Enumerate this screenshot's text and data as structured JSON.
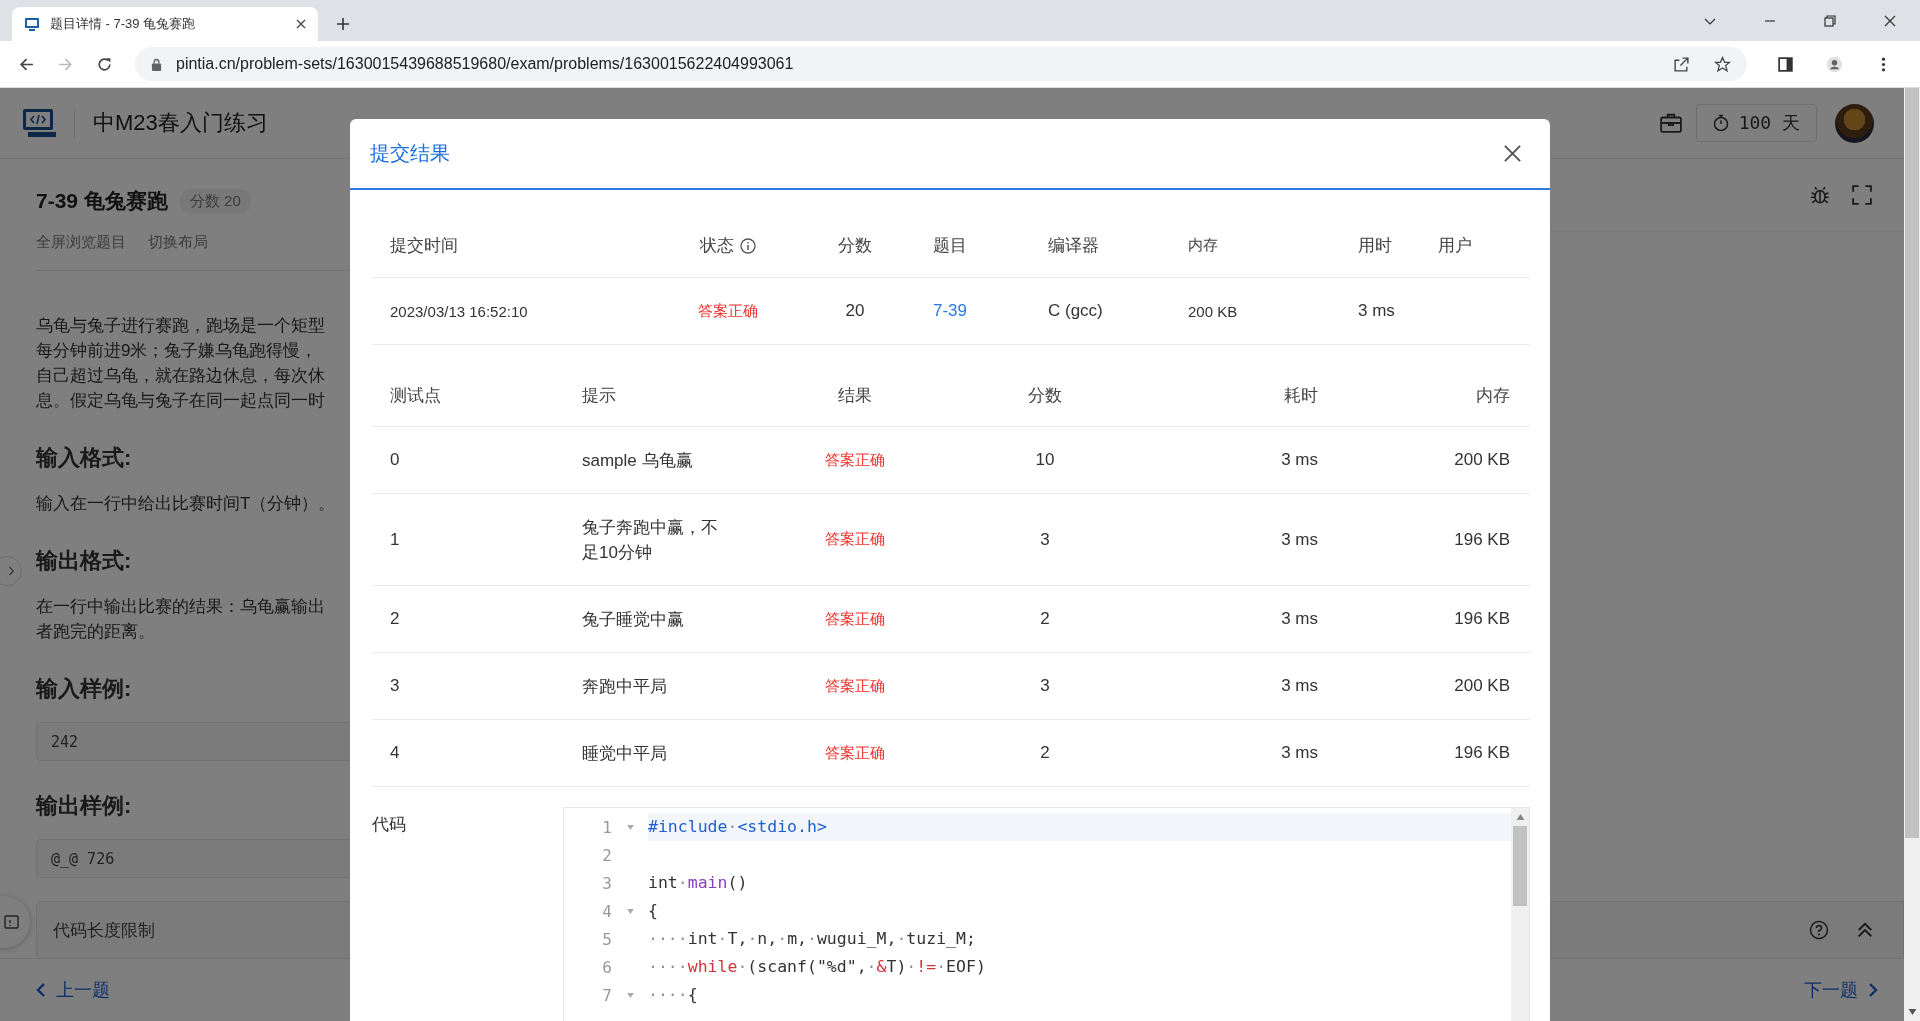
{
  "browser": {
    "tab_title": "题目详情 - 7-39 龟兔赛跑",
    "url": "pintia.cn/problem-sets/1630015439688519680/exam/problems/1630015622404993061",
    "forward_disabled": true
  },
  "header": {
    "course": "中M23春入门练习",
    "timer": "100 天"
  },
  "problem": {
    "title": "7-39 龟兔赛跑",
    "score_badge": "分数 20",
    "links": [
      "全屏浏览题目",
      "切换布局"
    ],
    "blocks": [
      {
        "kind": "text",
        "lines": [
          "乌龟与兔子进行赛跑，跑场是一个矩型",
          "每分钟前进9米；兔子嫌乌龟跑得慢，",
          "自己超过乌龟，就在路边休息，每次休",
          "息。假定乌龟与兔子在同一起点同一时"
        ]
      },
      {
        "kind": "heading",
        "lines": [
          "输入格式:"
        ]
      },
      {
        "kind": "text",
        "lines": [
          "输入在一行中给出比赛时间T（分钟）。"
        ]
      },
      {
        "kind": "heading",
        "lines": [
          "输出格式:"
        ]
      },
      {
        "kind": "text",
        "lines": [
          "在一行中输出比赛的结果：乌龟赢输出",
          "者跑完的距离。"
        ]
      },
      {
        "kind": "heading",
        "lines": [
          "输入样例:"
        ]
      },
      {
        "kind": "sample",
        "lines": [
          "242"
        ]
      },
      {
        "kind": "heading",
        "lines": [
          "输出样例:"
        ]
      },
      {
        "kind": "sample",
        "lines": [
          "@_@ 726"
        ]
      }
    ]
  },
  "limits_panel": "代码长度限制",
  "footer": {
    "prev": "上一题",
    "next": "下一题"
  },
  "dialog": {
    "title": "提交结果",
    "summary": {
      "columns": [
        "提交时间",
        "状态",
        "分数",
        "题目",
        "编译器",
        "内存",
        "用时",
        "用户"
      ],
      "row": {
        "time": "2023/03/13 16:52:10",
        "status": {
          "text": "答案正确",
          "kind": "accepted"
        },
        "score": "20",
        "problem": "7-39",
        "compiler": "C (gcc)",
        "memory": "200 KB",
        "duration": "3 ms"
      }
    },
    "tests": {
      "columns": [
        "测试点",
        "提示",
        "结果",
        "分数",
        "耗时",
        "内存"
      ],
      "rows": [
        {
          "case": "0",
          "hint": "sample 乌龟赢",
          "result": {
            "text": "答案正确",
            "kind": "accepted"
          },
          "score": "10",
          "duration": "3 ms",
          "memory": "200 KB"
        },
        {
          "case": "1",
          "hint": "兔子奔跑中赢，不足10分钟",
          "result": {
            "text": "答案正确",
            "kind": "accepted"
          },
          "score": "3",
          "duration": "3 ms",
          "memory": "196 KB"
        },
        {
          "case": "2",
          "hint": "兔子睡觉中赢",
          "result": {
            "text": "答案正确",
            "kind": "accepted"
          },
          "score": "2",
          "duration": "3 ms",
          "memory": "196 KB"
        },
        {
          "case": "3",
          "hint": "奔跑中平局",
          "result": {
            "text": "答案正确",
            "kind": "accepted"
          },
          "score": "3",
          "duration": "3 ms",
          "memory": "200 KB"
        },
        {
          "case": "4",
          "hint": "睡觉中平局",
          "result": {
            "text": "答案正确",
            "kind": "accepted"
          },
          "score": "2",
          "duration": "3 ms",
          "memory": "196 KB"
        }
      ]
    },
    "code_label": "代码",
    "code": [
      {
        "number": "1",
        "foldable": true,
        "active": true,
        "tokens": [
          {
            "kind": "pp",
            "text": "#include"
          },
          {
            "kind": "ws",
            "text": "·"
          },
          {
            "kind": "pp",
            "text": "<stdio.h>"
          }
        ]
      },
      {
        "number": "2",
        "foldable": false,
        "active": false
      },
      {
        "number": "3",
        "foldable": false,
        "active": false,
        "tokens": [
          {
            "kind": "plain",
            "text": "int"
          },
          {
            "kind": "ws",
            "text": "·"
          },
          {
            "kind": "fn",
            "text": "main"
          },
          {
            "kind": "plain",
            "text": "()"
          }
        ]
      },
      {
        "number": "4",
        "foldable": true,
        "active": false,
        "tokens": [
          {
            "kind": "plain",
            "text": "{"
          }
        ]
      },
      {
        "number": "5",
        "foldable": false,
        "active": false,
        "tokens": [
          {
            "kind": "ws",
            "text": "····"
          },
          {
            "kind": "plain",
            "text": "int"
          },
          {
            "kind": "ws",
            "text": "·"
          },
          {
            "kind": "plain",
            "text": "T,"
          },
          {
            "kind": "ws",
            "text": "·"
          },
          {
            "kind": "plain",
            "text": "n,"
          },
          {
            "kind": "ws",
            "text": "·"
          },
          {
            "kind": "plain",
            "text": "m,"
          },
          {
            "kind": "ws",
            "text": "·"
          },
          {
            "kind": "plain",
            "text": "wugui_M,"
          },
          {
            "kind": "ws",
            "text": "·"
          },
          {
            "kind": "plain",
            "text": "tuzi_M;"
          }
        ]
      },
      {
        "number": "6",
        "foldable": false,
        "active": false,
        "tokens": [
          {
            "kind": "ws",
            "text": "····"
          },
          {
            "kind": "kw",
            "text": "while"
          },
          {
            "kind": "ws",
            "text": "·"
          },
          {
            "kind": "plain",
            "text": "(scanf(\"%d\","
          },
          {
            "kind": "ws",
            "text": "·"
          },
          {
            "kind": "op",
            "text": "&"
          },
          {
            "kind": "plain",
            "text": "T)"
          },
          {
            "kind": "ws",
            "text": "·"
          },
          {
            "kind": "op",
            "text": "!="
          },
          {
            "kind": "ws",
            "text": "·"
          },
          {
            "kind": "plain",
            "text": "EOF)"
          }
        ]
      },
      {
        "number": "7",
        "foldable": true,
        "active": false,
        "tokens": [
          {
            "kind": "ws",
            "text": "····"
          },
          {
            "kind": "plain",
            "text": "{"
          }
        ]
      }
    ]
  }
}
